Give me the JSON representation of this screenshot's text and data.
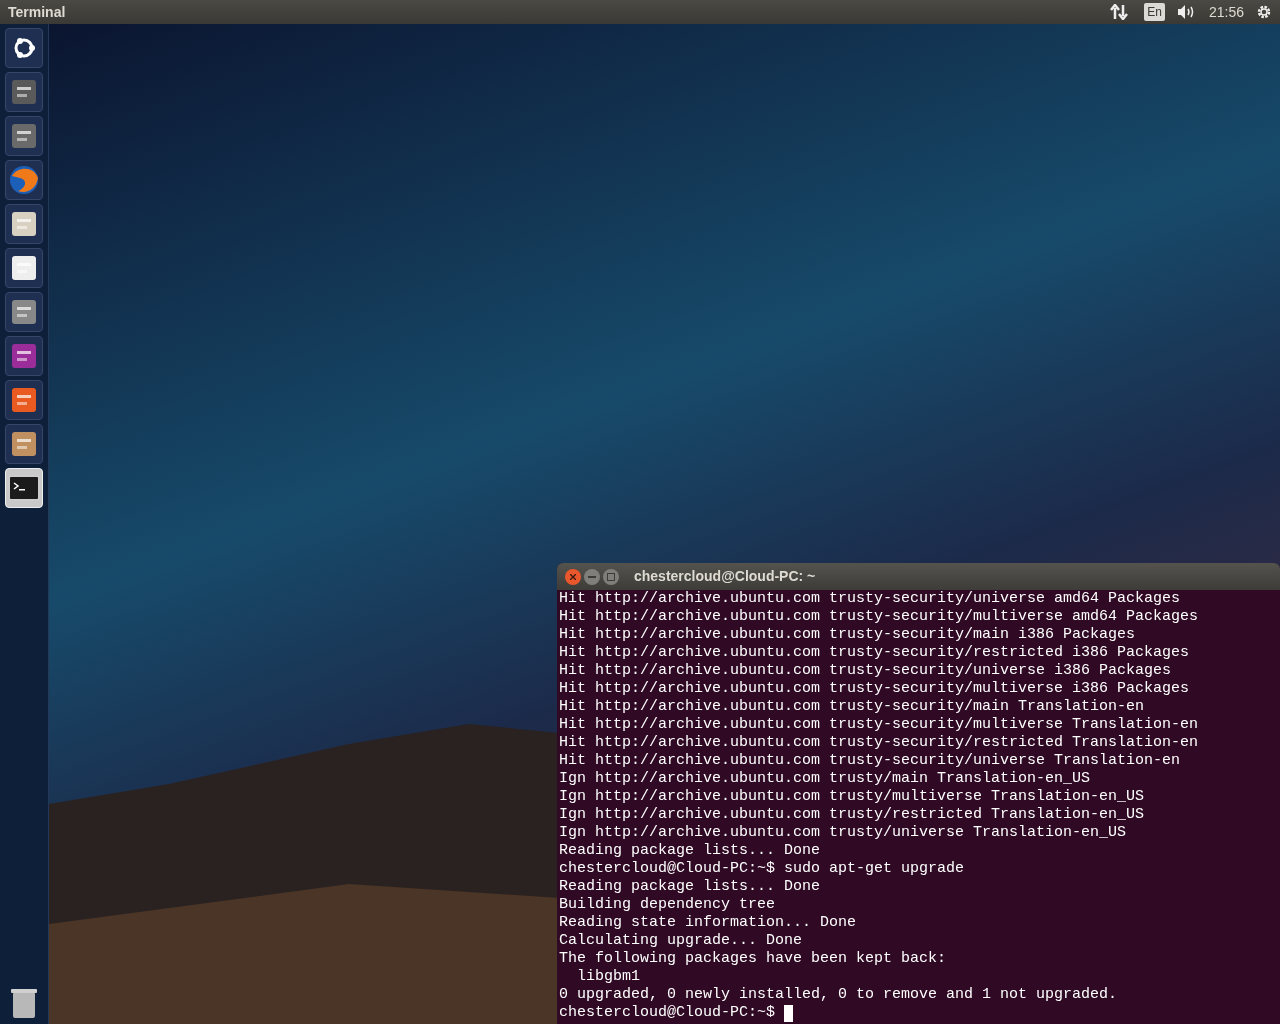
{
  "top_panel": {
    "title": "Terminal",
    "keyboard_layout": "En",
    "clock": "21:56"
  },
  "launcher": {
    "items": [
      {
        "active": false
      },
      {
        "active": false
      },
      {
        "active": false
      },
      {
        "active": false
      },
      {
        "active": false
      },
      {
        "active": false
      },
      {
        "active": false
      },
      {
        "active": false
      },
      {
        "active": false
      },
      {
        "active": false
      },
      {
        "active": true
      }
    ]
  },
  "terminal": {
    "title": "chestercloud@Cloud-PC: ~",
    "cursor": true,
    "lines": [
      "Hit http://archive.ubuntu.com trusty-security/universe amd64 Packages",
      "Hit http://archive.ubuntu.com trusty-security/multiverse amd64 Packages",
      "Hit http://archive.ubuntu.com trusty-security/main i386 Packages",
      "Hit http://archive.ubuntu.com trusty-security/restricted i386 Packages",
      "Hit http://archive.ubuntu.com trusty-security/universe i386 Packages",
      "Hit http://archive.ubuntu.com trusty-security/multiverse i386 Packages",
      "Hit http://archive.ubuntu.com trusty-security/main Translation-en",
      "Hit http://archive.ubuntu.com trusty-security/multiverse Translation-en",
      "Hit http://archive.ubuntu.com trusty-security/restricted Translation-en",
      "Hit http://archive.ubuntu.com trusty-security/universe Translation-en",
      "Ign http://archive.ubuntu.com trusty/main Translation-en_US",
      "Ign http://archive.ubuntu.com trusty/multiverse Translation-en_US",
      "Ign http://archive.ubuntu.com trusty/restricted Translation-en_US",
      "Ign http://archive.ubuntu.com trusty/universe Translation-en_US",
      "Reading package lists... Done",
      "chestercloud@Cloud-PC:~$ sudo apt-get upgrade",
      "Reading package lists... Done",
      "Building dependency tree",
      "Reading state information... Done",
      "Calculating upgrade... Done",
      "The following packages have been kept back:",
      "  libgbm1",
      "0 upgraded, 0 newly installed, 0 to remove and 1 not upgraded.",
      "chestercloud@Cloud-PC:~$"
    ]
  }
}
